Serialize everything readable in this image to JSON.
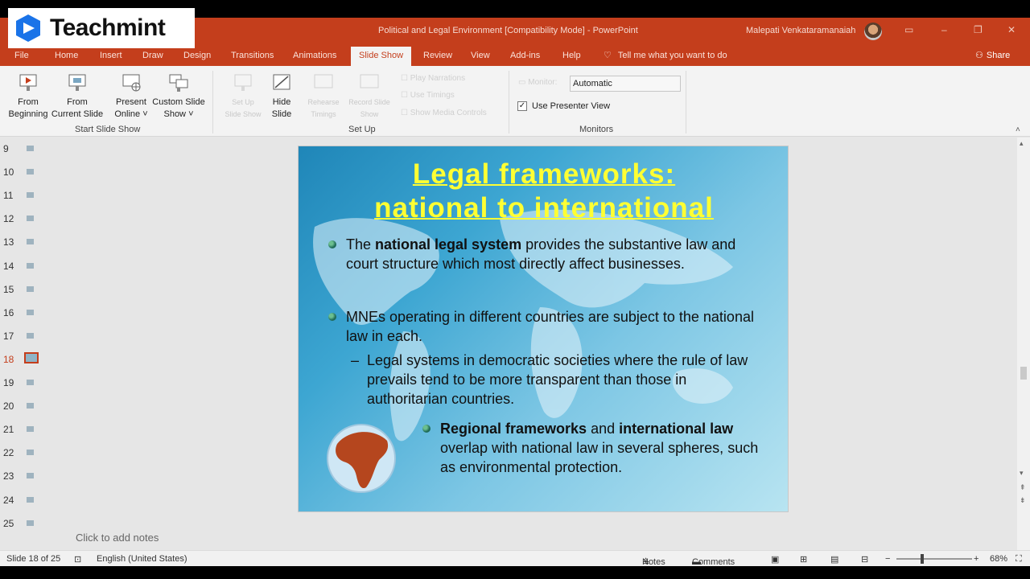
{
  "watermark": {
    "logo_text": "Teachmint"
  },
  "titlebar": {
    "doc_title": "Political and Legal Environment [Compatibility Mode] - PowerPoint",
    "user_name": "Malepati Venkataramanaiah"
  },
  "menu": {
    "tabs": [
      "File",
      "Home",
      "Insert",
      "Draw",
      "Design",
      "Transitions",
      "Animations",
      "Slide Show",
      "Review",
      "View",
      "Add-ins",
      "Help"
    ],
    "active_tab": "Slide Show",
    "tell_me": "Tell me what you want to do",
    "share": "Share"
  },
  "ribbon": {
    "from_beginning": [
      "From",
      "Beginning"
    ],
    "from_current": [
      "From",
      "Current Slide"
    ],
    "present_online": [
      "Present",
      "Online"
    ],
    "custom_show": [
      "Custom Slide",
      "Show"
    ],
    "setup_slideshow": [
      "Set Up",
      "Slide Show"
    ],
    "hide_slide": [
      "Hide",
      "Slide"
    ],
    "rehearse": [
      "Rehearse",
      "Timings"
    ],
    "record": [
      "Record Slide",
      "Show"
    ],
    "play_narrations": "Play Narrations",
    "use_timings": "Use Timings",
    "show_media": "Show Media Controls",
    "monitor_label": "Monitor:",
    "monitor_value": "Automatic",
    "use_presenter_view": "Use Presenter View",
    "use_presenter_view_checked": true,
    "groups": {
      "start": "Start Slide Show",
      "setup": "Set Up",
      "monitors": "Monitors"
    }
  },
  "thumbnails": {
    "numbers": [
      "9",
      "10",
      "11",
      "12",
      "13",
      "14",
      "15",
      "16",
      "17",
      "18",
      "19",
      "20",
      "21",
      "22",
      "23",
      "24",
      "25"
    ],
    "selected": "18"
  },
  "slide": {
    "title_line1": "Legal frameworks:",
    "title_line2": "national to international",
    "b1_pre": "The ",
    "b1_bold": "national legal system",
    "b1_post": " provides the substantive law and court structure which most directly affect businesses.",
    "b2": "MNEs operating in different countries are subject to the national law in each.",
    "b3_dash": "–",
    "b3": "Legal systems in democratic societies where the rule of law prevails tend to be more transparent than those in authoritarian countries.",
    "b4_bold1": "Regional frameworks",
    "b4_mid": " and ",
    "b4_bold2": "international law",
    "b4_post": " overlap with national law in several spheres, such as environmental protection."
  },
  "notes": {
    "placeholder": "Click to add notes"
  },
  "status": {
    "slide_info": "Slide 18 of 25",
    "language": "English (United States)",
    "notes": "Notes",
    "comments": "Comments",
    "zoom": "68%",
    "zoom_fraction": 0.68
  },
  "colors": {
    "accent": "#c43e1c",
    "title_yellow": "#ffff33"
  }
}
